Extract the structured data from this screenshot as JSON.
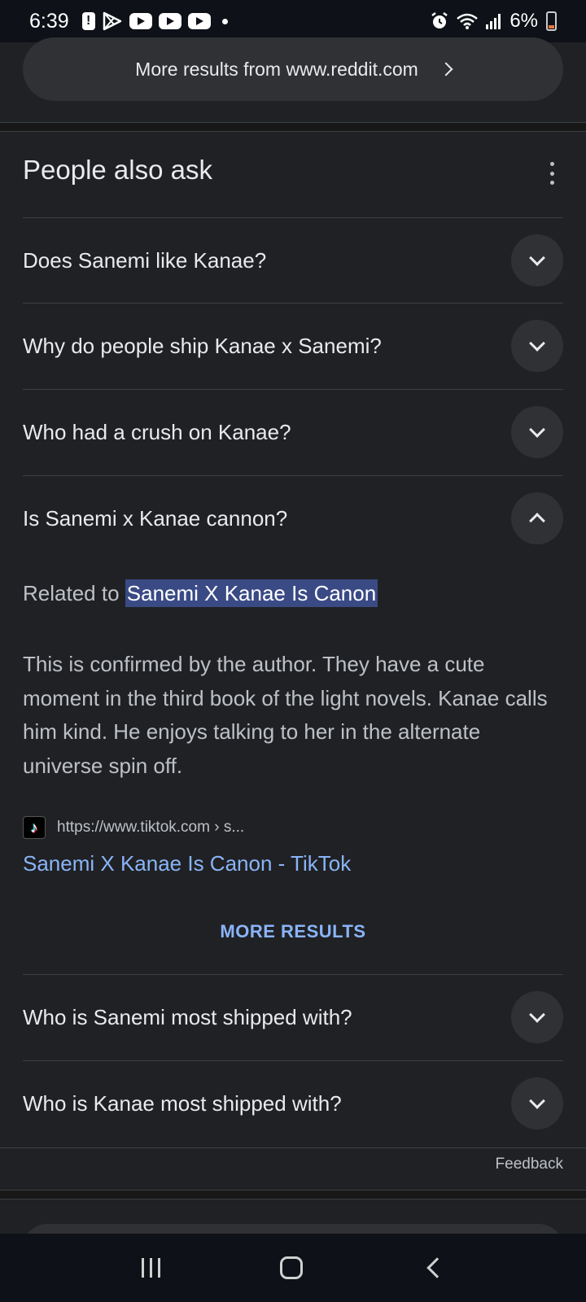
{
  "status_bar": {
    "time": "6:39",
    "battery_percent": "6%",
    "icons": [
      "alert-icon",
      "play-store-icon",
      "youtube-icon",
      "youtube-icon",
      "youtube-icon",
      "notification-dot",
      "alarm-icon",
      "wifi-icon",
      "signal-icon",
      "battery-icon"
    ]
  },
  "more_results_reddit": "More results from www.reddit.com",
  "paa": {
    "title": "People also ask",
    "questions": [
      {
        "text": "Does Sanemi like Kanae?",
        "expanded": false
      },
      {
        "text": "Why do people ship Kanae x Sanemi?",
        "expanded": false
      },
      {
        "text": "Who had a crush on Kanae?",
        "expanded": false
      },
      {
        "text": "Is Sanemi x Kanae cannon?",
        "expanded": true
      },
      {
        "text": "Who is Sanemi most shipped with?",
        "expanded": false
      },
      {
        "text": "Who is Kanae most shipped with?",
        "expanded": false
      }
    ],
    "related_prefix": "Related to",
    "related_highlight": "Sanemi X Kanae Is Canon",
    "answer": "This is confirmed by the author. They have a cute moment in the third book of the light novels. Kanae calls him kind. He enjoys talking to her in the alternate universe spin off.",
    "source_url": "https://www.tiktok.com › s...",
    "source_title": "Sanemi X Kanae Is Canon - TikTok",
    "more_results": "MORE RESULTS"
  },
  "feedback": "Feedback",
  "colors": {
    "background": "#202124",
    "link": "#8ab4f8",
    "highlight": "#3a4a85"
  }
}
